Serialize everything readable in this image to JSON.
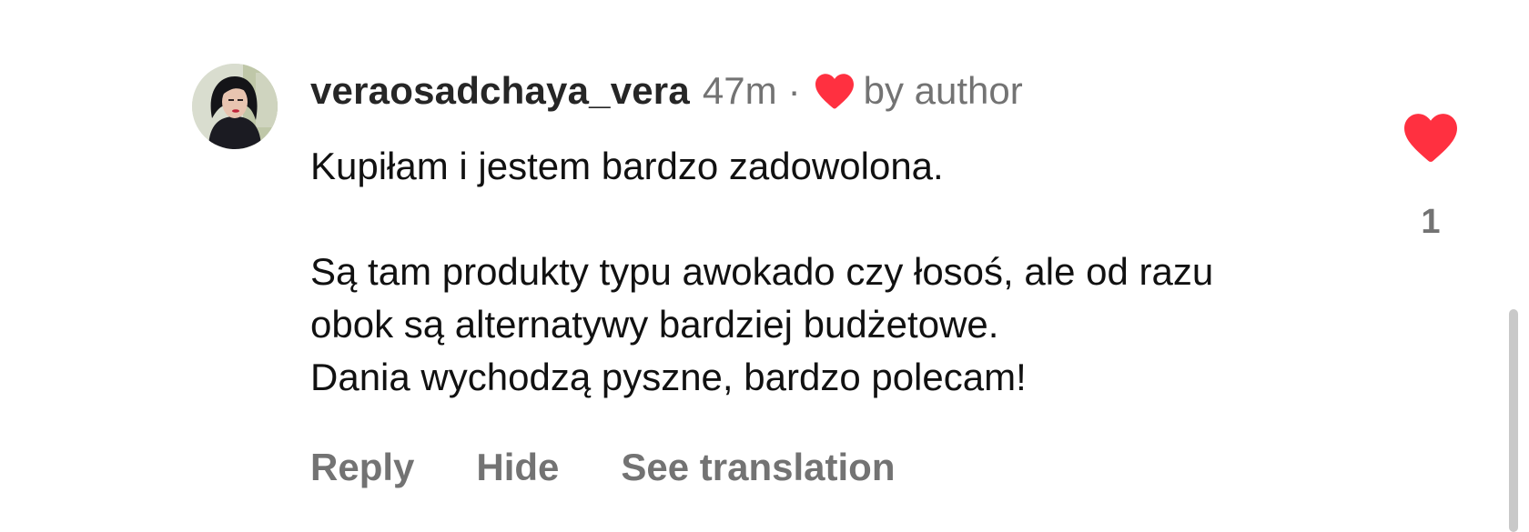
{
  "comment": {
    "username": "veraosadchaya_vera",
    "time": "47m",
    "separator": "·",
    "liked_by_author_label": "by author",
    "body_lines": [
      "Kupiłam i jestem bardzo zadowolona.",
      "Są tam produkty typu awokado czy łosoś, ale od razu",
      "obok są alternatywy bardziej budżetowe.",
      "Dania wychodzą pyszne, bardzo polecam!"
    ],
    "like_count": "1",
    "liked": true
  },
  "actions": {
    "reply_label": "Reply",
    "hide_label": "Hide",
    "see_translation_label": "See translation"
  },
  "icons": {
    "author_like": "heart-icon",
    "like_button": "heart-filled-icon"
  },
  "colors": {
    "heart": "#ff3040",
    "secondary_text": "#737373",
    "username": "#262626"
  }
}
